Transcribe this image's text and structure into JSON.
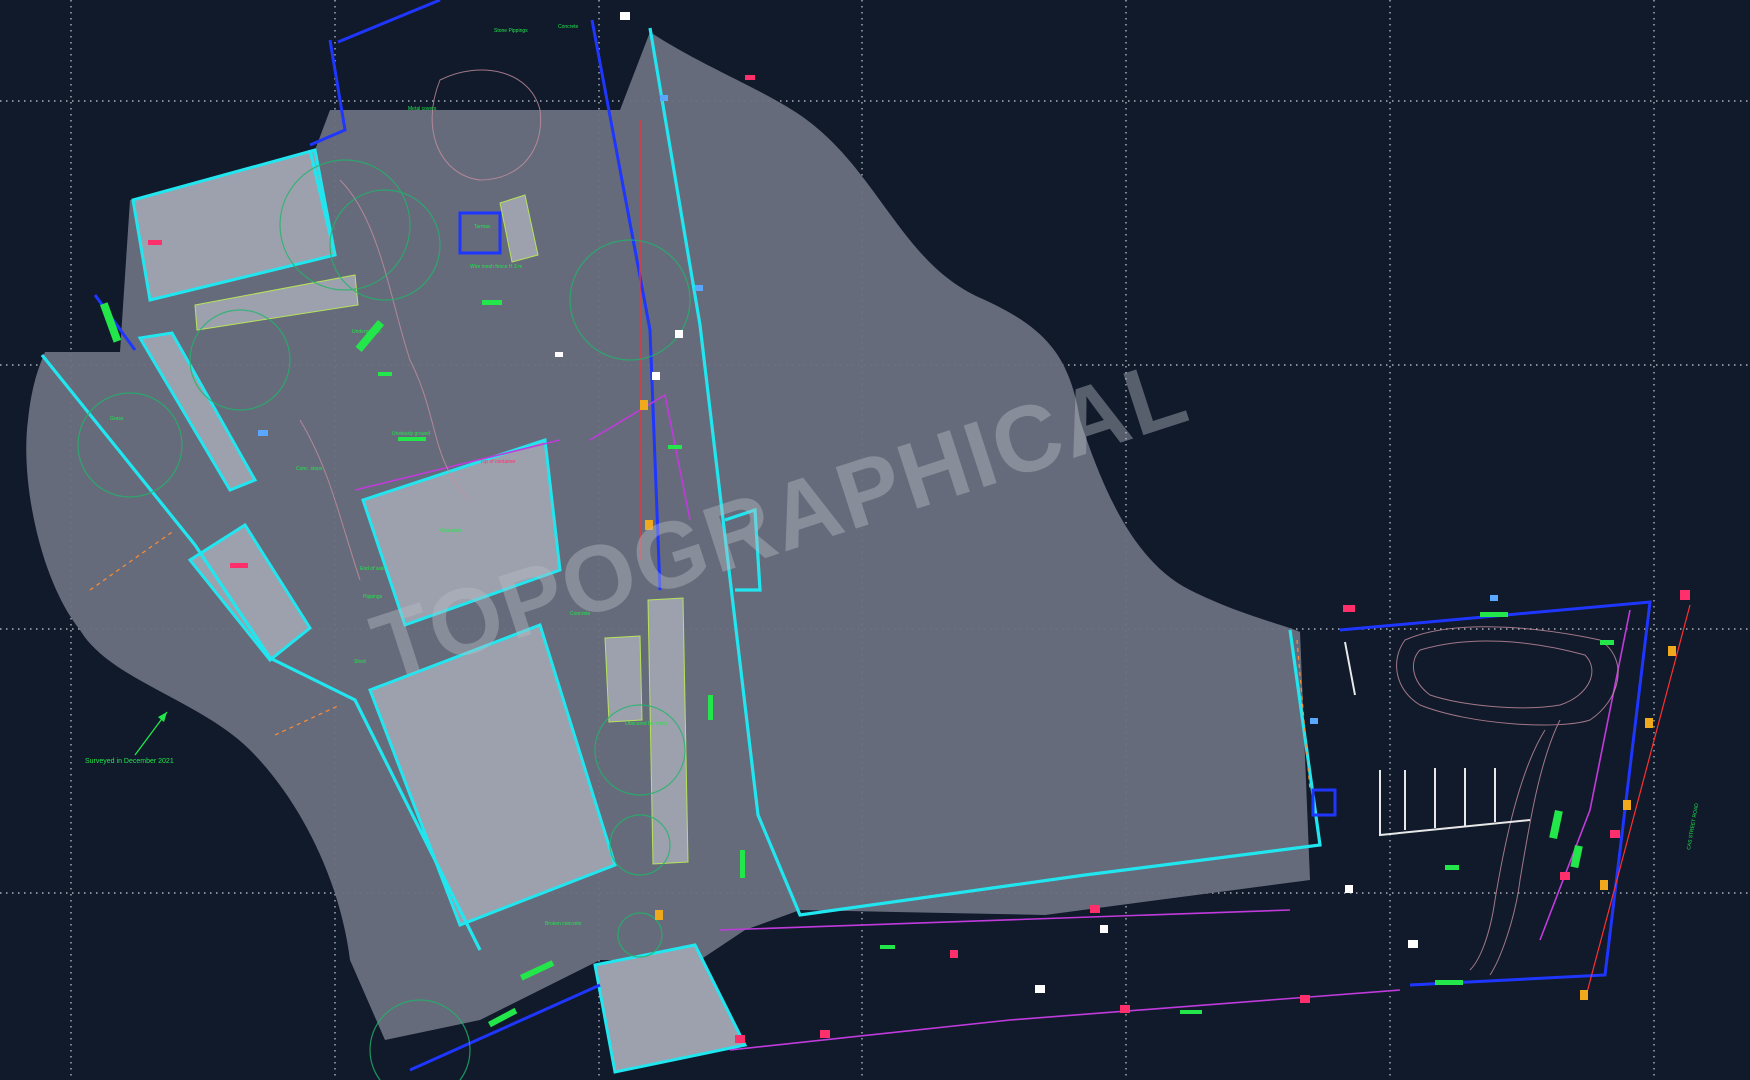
{
  "colors": {
    "background": "#101a2b",
    "grid": "#c8cdd6",
    "footprint_fill": "#6a7080",
    "building_fill": "#9da1ad",
    "site_boundary": "#22e6ef",
    "fence": "#1f36ff",
    "label_green": "#22e64a",
    "label_red": "#ff2f6c",
    "watermark": "#b9bcc6"
  },
  "watermark": {
    "text": "TOPOGRAPHICAL"
  },
  "annotations": {
    "survey_note": "Surveyed in December 2021",
    "vertical_road_label": "CAS STREET ROAD",
    "labels": [
      "Concrete",
      "Stone Pippings",
      "Metal covers",
      "Tarmac",
      "Wire mesh fence H 3 m",
      "Grass",
      "Undergrowth",
      "Unsteady ground",
      "Top of container",
      "End of wall",
      "Pippings",
      "Concrete",
      "Obscured by shrub",
      "Broken concrete",
      "Conc. steps",
      "Shed",
      "Container"
    ]
  }
}
